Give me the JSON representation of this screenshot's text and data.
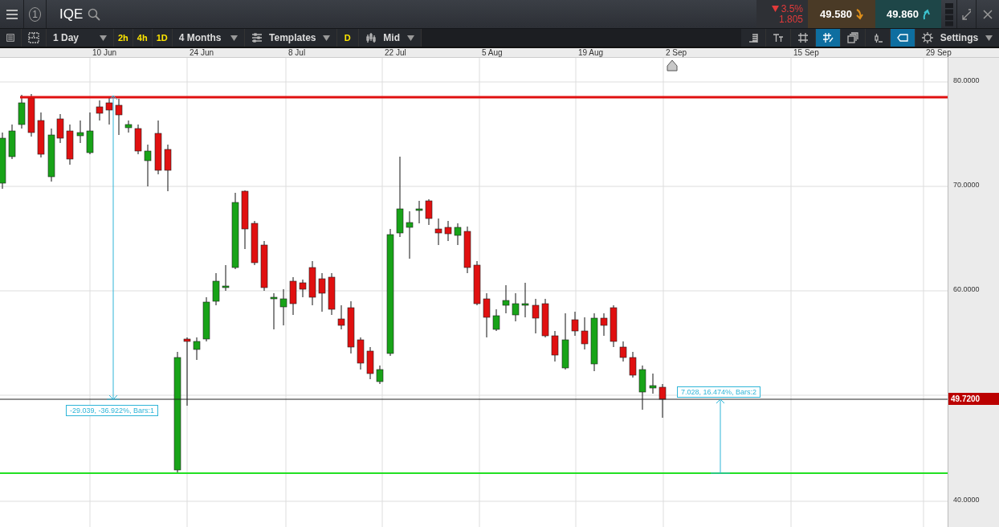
{
  "header": {
    "step": "1",
    "symbol": "IQE",
    "change": {
      "down": true,
      "percent": "3.5%",
      "points": "1.805"
    },
    "sell": "49.580",
    "buy": "49.860"
  },
  "toolbar": {
    "interval": "1 Day",
    "quick_intervals": [
      "2h",
      "4h",
      "1D"
    ],
    "range": "4 Months",
    "templates": "Templates",
    "mode_flag": "D",
    "price_type": "Mid",
    "tools": [
      {
        "kind": "align",
        "selected": false
      },
      {
        "kind": "text",
        "selected": false
      },
      {
        "kind": "grid",
        "selected": false
      },
      {
        "kind": "draw",
        "selected": true
      },
      {
        "kind": "layers",
        "selected": false
      },
      {
        "kind": "crosshair",
        "selected": false
      },
      {
        "kind": "label",
        "selected": true
      }
    ],
    "settings": "Settings"
  },
  "chart": {
    "x_axis_labels": [
      "10 Jun",
      "24 Jun",
      "8 Jul",
      "22 Jul",
      "5 Aug",
      "19 Aug",
      "2 Sep",
      "15 Sep",
      "29 Sep"
    ],
    "y_axis_labels": [
      "80.0000",
      "70.0000",
      "60.0000",
      "40.0000"
    ],
    "current_price": "49.7200",
    "measurements": [
      "-29.039, -36.922%, Bars:1",
      "7.028, 16.474%, Bars:2"
    ]
  }
}
